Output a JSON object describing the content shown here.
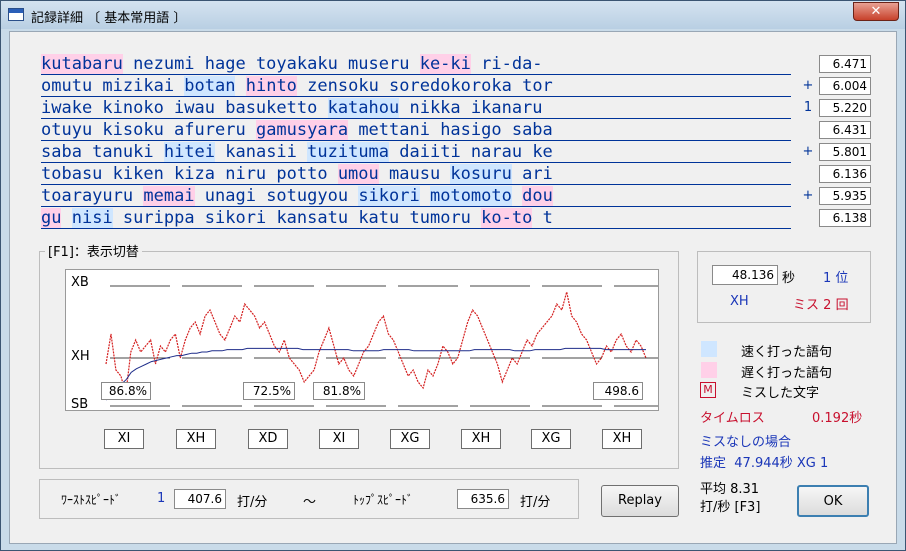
{
  "window": {
    "title": "記録詳細 〔 基本常用語 〕",
    "close_label": "✕"
  },
  "lines": [
    {
      "segs": [
        [
          "kutabaru",
          "s"
        ],
        [
          " nezumi hage toyakaku museru ",
          ""
        ],
        [
          "ke-ki",
          "s"
        ],
        [
          " ri-da-",
          ""
        ]
      ],
      "mark": "",
      "value": "6.471"
    },
    {
      "segs": [
        [
          "omutu mizikai ",
          ""
        ],
        [
          "botan",
          "f"
        ],
        [
          " ",
          ""
        ],
        [
          "hinto",
          "s"
        ],
        [
          " zensoku soredokoroka tor",
          ""
        ]
      ],
      "mark": "+",
      "value": "6.004"
    },
    {
      "segs": [
        [
          "iwake kinoko iwau basuketto ",
          ""
        ],
        [
          "katahou",
          "f"
        ],
        [
          " nikka ikanaru",
          ""
        ]
      ],
      "mark": "1",
      "value": "5.220"
    },
    {
      "segs": [
        [
          "otuyu kisoku afureru ",
          ""
        ],
        [
          "g",
          "s"
        ],
        [
          "amusyara",
          "s"
        ],
        [
          " mettani hasigo saba",
          ""
        ]
      ],
      "mark": "",
      "value": "6.431"
    },
    {
      "segs": [
        [
          "saba tanuki ",
          ""
        ],
        [
          "hitei",
          "f"
        ],
        [
          " kanasii ",
          ""
        ],
        [
          "tuzituma",
          "f"
        ],
        [
          " daiiti narau ke",
          ""
        ]
      ],
      "mark": "+",
      "value": "5.801"
    },
    {
      "segs": [
        [
          "tobasu kiken kiza niru potto ",
          ""
        ],
        [
          "umou",
          "s"
        ],
        [
          " mausu ",
          ""
        ],
        [
          "kosuru",
          "f"
        ],
        [
          " ari",
          ""
        ]
      ],
      "mark": "",
      "value": "6.136"
    },
    {
      "segs": [
        [
          "toarayuru ",
          ""
        ],
        [
          "memai",
          "s"
        ],
        [
          " unagi sotugyou ",
          ""
        ],
        [
          "sikori",
          "f"
        ],
        [
          " ",
          ""
        ],
        [
          "motomoto",
          "f"
        ],
        [
          " ",
          ""
        ],
        [
          "dou",
          "s"
        ]
      ],
      "mark": "+",
      "value": "5.935"
    },
    {
      "segs": [
        [
          "gu",
          "s"
        ],
        [
          " ",
          ""
        ],
        [
          "nisi",
          "f"
        ],
        [
          " surippa sikori kansatu katu tumoru ",
          ""
        ],
        [
          "ko-to",
          "s"
        ],
        [
          " t",
          ""
        ]
      ],
      "mark": "",
      "value": "6.138"
    }
  ],
  "display_group": {
    "label": "[F1]：表示切替"
  },
  "chart_data": {
    "type": "line",
    "y_tick_labels": [
      "XB",
      "XH",
      "SB"
    ],
    "series": [
      {
        "color": "#d42020",
        "values": [
          0.35,
          0.6,
          0.3,
          0.25,
          0.1,
          0.45,
          0.55,
          0.45,
          0.5,
          0.55,
          0.35,
          0.5,
          0.45,
          0.55,
          0.6,
          0.4,
          0.55,
          0.65,
          0.7,
          0.6,
          0.75,
          0.8,
          0.7,
          0.6,
          0.55,
          0.65,
          0.75,
          0.7,
          0.85,
          0.8,
          0.75,
          0.65,
          0.7,
          0.6,
          0.5,
          0.45,
          0.55,
          0.4,
          0.35,
          0.3,
          0.2,
          0.25,
          0.3,
          0.45,
          0.55,
          0.65,
          0.5,
          0.35,
          0.4,
          0.3,
          0.25,
          0.35,
          0.45,
          0.5,
          0.6,
          0.7,
          0.75,
          0.6,
          0.55,
          0.45,
          0.35,
          0.25,
          0.3,
          0.2,
          0.15,
          0.3,
          0.25,
          0.35,
          0.5,
          0.45,
          0.35,
          0.4,
          0.55,
          0.7,
          0.8,
          0.75,
          0.65,
          0.55,
          0.45,
          0.35,
          0.2,
          0.3,
          0.4,
          0.35,
          0.45,
          0.55,
          0.5,
          0.6,
          0.65,
          0.7,
          0.75,
          0.85,
          0.8,
          0.95,
          0.75,
          0.7,
          0.6,
          0.55,
          0.45,
          0.35,
          0.4,
          0.5,
          0.45,
          0.55,
          0.6,
          0.5,
          0.45,
          0.55,
          0.5,
          0.4
        ]
      },
      {
        "color": "#1e2d8a",
        "values": [
          0.05,
          0.08,
          0.1,
          0.18,
          0.22,
          0.28,
          0.31,
          0.33,
          0.35,
          0.37,
          0.38,
          0.39,
          0.4,
          0.41,
          0.42,
          0.42,
          0.43,
          0.44,
          0.44,
          0.45,
          0.45,
          0.46,
          0.46,
          0.46,
          0.47,
          0.47,
          0.47,
          0.47,
          0.48,
          0.48,
          0.48,
          0.48,
          0.48,
          0.48,
          0.48,
          0.48,
          0.48,
          0.48,
          0.48,
          0.47,
          0.47,
          0.47,
          0.47,
          0.47,
          0.47,
          0.47,
          0.47,
          0.47,
          0.47,
          0.46,
          0.46,
          0.46,
          0.46,
          0.46,
          0.46,
          0.47,
          0.47,
          0.47,
          0.47,
          0.47,
          0.47,
          0.46,
          0.46,
          0.46,
          0.46,
          0.46,
          0.46,
          0.46,
          0.46,
          0.46,
          0.46,
          0.46,
          0.46,
          0.47,
          0.47,
          0.47,
          0.47,
          0.47,
          0.47,
          0.47,
          0.47,
          0.46,
          0.46,
          0.46,
          0.46,
          0.47,
          0.47,
          0.47,
          0.47,
          0.47,
          0.47,
          0.48,
          0.48,
          0.48,
          0.48,
          0.48,
          0.48,
          0.48,
          0.48,
          0.47,
          0.47,
          0.47,
          0.47,
          0.47,
          0.47,
          0.47,
          0.47,
          0.47
        ]
      }
    ],
    "percent_boxes": [
      "86.8%",
      "72.5%",
      "81.8%",
      "498.6"
    ],
    "grades": [
      "XI",
      "XH",
      "XD",
      "XI",
      "XG",
      "XH",
      "XG",
      "XH"
    ]
  },
  "result": {
    "time": "48.136",
    "sec_unit": "秒",
    "rank": "1 位",
    "grade": "XH",
    "miss_label": "ミス",
    "miss_count": "2",
    "miss_unit": "回"
  },
  "legend": {
    "fast": "速く打った語句",
    "slow": "遅く打った語句",
    "miss_char_icon": "M",
    "miss": "ミスした文字",
    "fast_color": "#cfe6ff",
    "slow_color": "#ffd0e8"
  },
  "loss": {
    "label": "タイムロス",
    "value": "0.192秒"
  },
  "nomiss": {
    "label": "ミスなしの場合",
    "estimate_label": "推定",
    "value": "47.944秒 XG 1"
  },
  "speed": {
    "worst_label": "ﾜｰｽﾄｽﾋﾟｰﾄﾞ",
    "worst_index": "1",
    "worst_value": "407.6",
    "unit": "打/分",
    "tilde": "〜",
    "top_label": "ﾄｯﾌﾟｽﾋﾟｰﾄﾞ",
    "top_value": "635.6"
  },
  "buttons": {
    "replay": "Replay",
    "ok": "OK"
  },
  "average": {
    "line1": "平均 8.31",
    "line2": "打/秒 [F3]"
  }
}
